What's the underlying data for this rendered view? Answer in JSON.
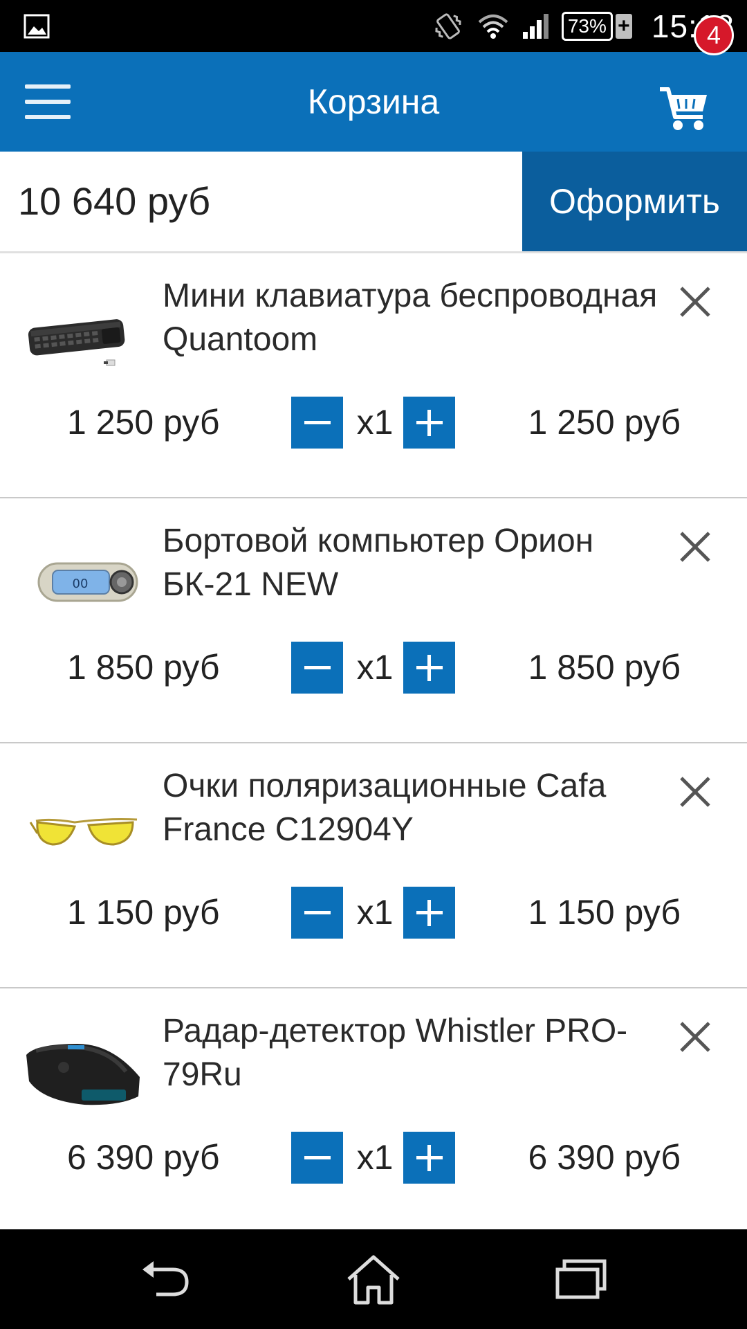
{
  "status_bar": {
    "time": "15:18",
    "battery": "73%",
    "icons": [
      "image-icon",
      "vibrate-icon",
      "wifi-icon",
      "signal-icon",
      "battery-icon",
      "charging-icon"
    ]
  },
  "app_bar": {
    "title": "Корзина",
    "cart_count": "4"
  },
  "summary": {
    "total": "10 640 руб",
    "checkout_label": "Оформить"
  },
  "items": [
    {
      "name": "Мини клавиатура беспроводная Quantoom",
      "price": "1 250 руб",
      "qty": "x1",
      "total": "1 250 руб"
    },
    {
      "name": "Бортовой компьютер Орион БК-21 NEW",
      "price": "1 850 руб",
      "qty": "x1",
      "total": "1 850 руб"
    },
    {
      "name": "Очки поляризационные Cafa France C12904Y",
      "price": "1 150 руб",
      "qty": "x1",
      "total": "1 150 руб"
    },
    {
      "name": "Радар-детектор Whistler PRO-79Ru",
      "price": "6 390 руб",
      "qty": "x1",
      "total": "6 390 руб"
    }
  ],
  "colors": {
    "primary": "#0b70b9",
    "checkout": "#0b5e9d",
    "badge": "#d6182a"
  }
}
